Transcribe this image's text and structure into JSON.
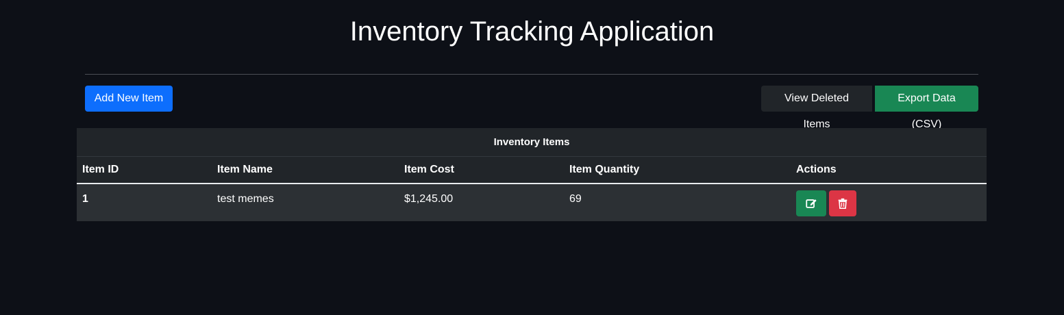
{
  "header": {
    "title": "Inventory Tracking Application"
  },
  "toolbar": {
    "add_label": "Add New Item",
    "deleted_label": "View Deleted Items",
    "export_label": "Export Data (CSV)"
  },
  "table": {
    "caption": "Inventory Items",
    "columns": [
      "Item ID",
      "Item Name",
      "Item Cost",
      "Item Quantity",
      "Actions"
    ],
    "rows": [
      {
        "id": "1",
        "name": "test memes",
        "cost": "$1,245.00",
        "quantity": "69"
      }
    ]
  },
  "colors": {
    "background": "#0d1017",
    "primary": "#0d6efd",
    "success": "#198754",
    "danger": "#dc3545",
    "dark": "#212529"
  },
  "icons": {
    "edit": "edit-icon",
    "delete": "trash-icon"
  }
}
